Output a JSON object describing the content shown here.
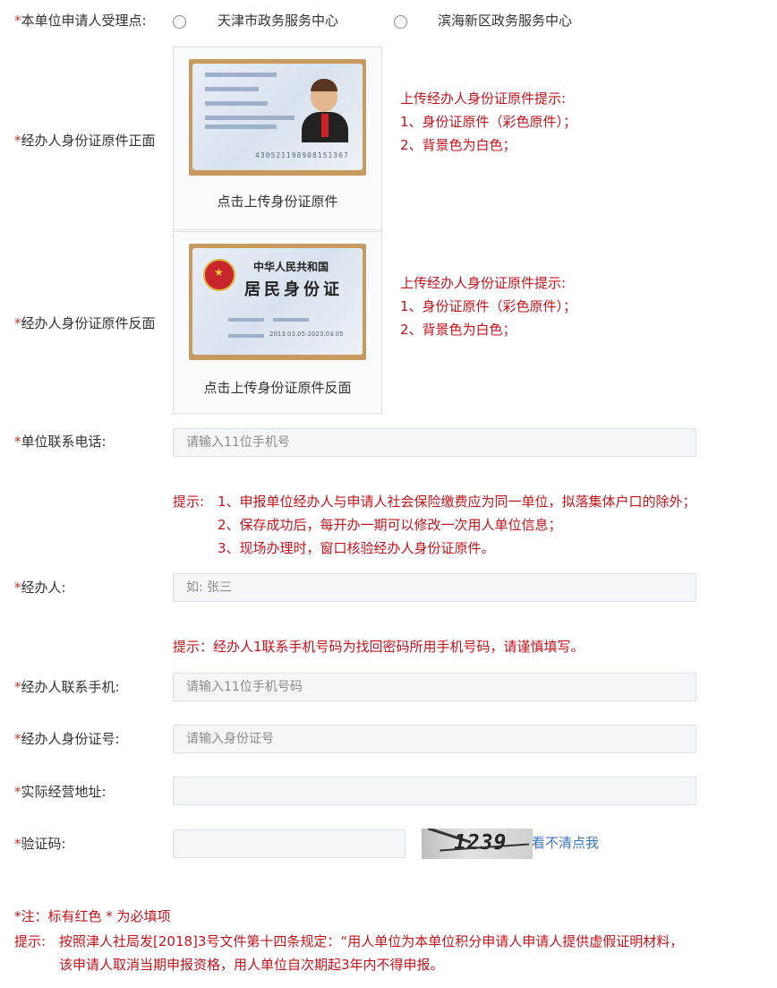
{
  "accept_point": {
    "star": "*",
    "label": "本单位申请人受理点:",
    "options": [
      "天津市政务服务中心",
      "滨海新区政务服务中心"
    ]
  },
  "id_front": {
    "star": "*",
    "label": "经办人身份证原件正面",
    "caption": "点击上传身份证原件",
    "hint_title": "上传经办人身份证原件提示:",
    "hint_1": "1、身份证原件（彩色原件）；",
    "hint_2": "2、背景色为白色；",
    "card_number": "430521198908151367"
  },
  "id_back": {
    "star": "*",
    "label": "经办人身份证原件反面",
    "caption": "点击上传身份证原件反面",
    "hint_title": "上传经办人身份证原件提示:",
    "hint_1": "1、身份证原件（彩色原件）；",
    "hint_2": "2、背景色为白色；",
    "card_title_1": "中华人民共和国",
    "card_title_2": "居民身份证",
    "card_valid": "2013.03.05-2023.03.05"
  },
  "unit_phone": {
    "star": "*",
    "label": "单位联系电话:",
    "placeholder": "请输入11位手机号"
  },
  "unit_tip": {
    "prefix": "提示:",
    "line_1": "1、申报单位经办人与申请人社会保险缴费应为同一单位，拟落集体户口的除外；",
    "line_2": "2、保存成功后，每开办一期可以修改一次用人单位信息；",
    "line_3": "3、现场办理时，窗口核验经办人身份证原件。"
  },
  "handler": {
    "star": "*",
    "label": "经办人:",
    "placeholder": "如: 张三"
  },
  "handler_tip": "提示：经办人1联系手机号码为找回密码所用手机号码，请谨慎填写。",
  "handler_mobile": {
    "star": "*",
    "label": "经办人联系手机:",
    "placeholder": "请输入11位手机号码"
  },
  "handler_id": {
    "star": "*",
    "label": "经办人身份证号:",
    "placeholder": "请输入身份证号"
  },
  "address": {
    "star": "*",
    "label": "实际经营地址:",
    "placeholder": ""
  },
  "captcha": {
    "star": "*",
    "label": "验证码:",
    "placeholder": "",
    "image_text": "1239",
    "refresh_link": "看不清点我"
  },
  "footer": {
    "note": "*注：标有红色 * 为必填项",
    "tip_prefix": "提示:",
    "tip_line_1": "按照津人社局发[2018]3号文件第十四条规定：“用人单位为本单位积分申请人申请人提供虚假证明材料，",
    "tip_line_2": "该申请人取消当期申报资格，用人单位自次期起3年内不得申报。"
  },
  "colors": {
    "required_red": "#c0392b",
    "hint_red": "#c0141d",
    "link_blue": "#3b73c1",
    "input_bg": "#f5f6f8"
  }
}
